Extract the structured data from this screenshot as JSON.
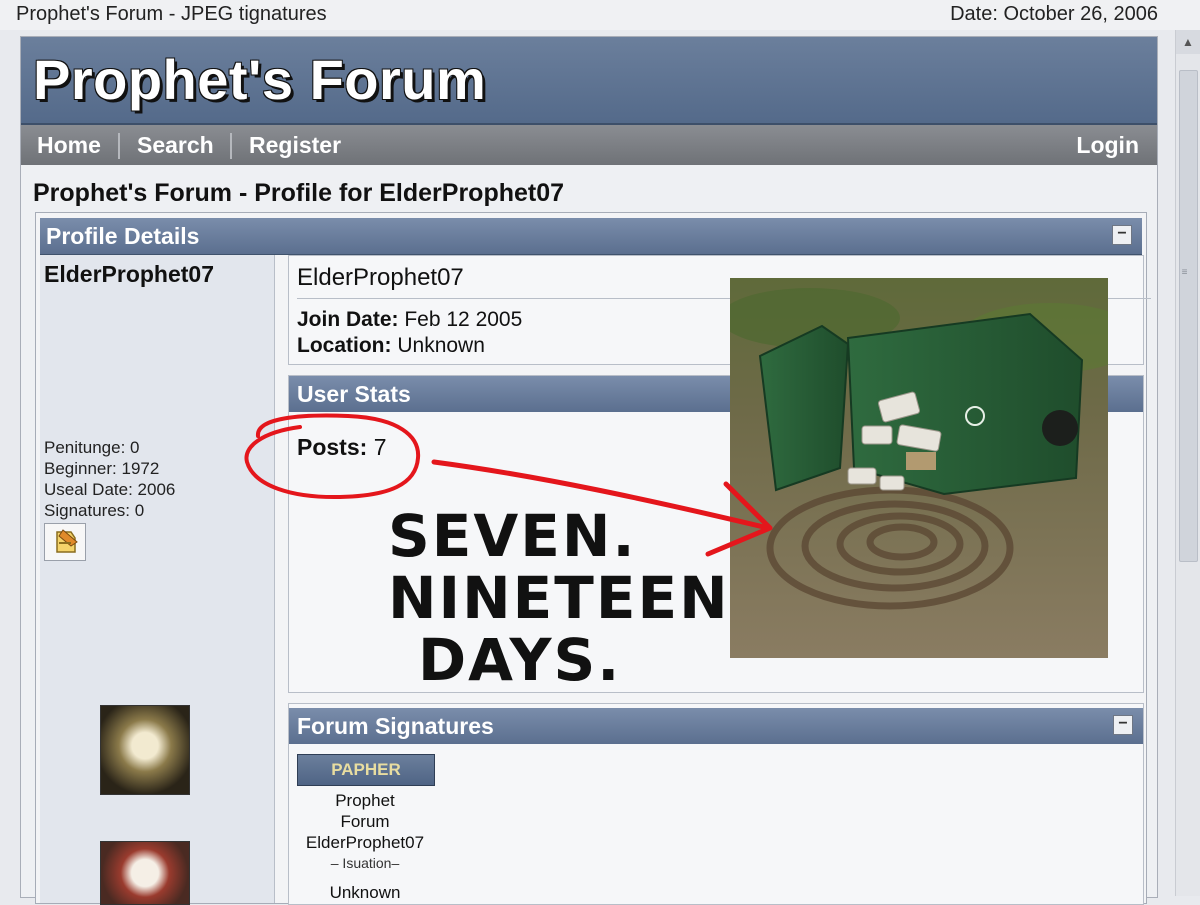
{
  "window": {
    "title": "Prophet's Forum - JPEG tignatures",
    "date": "Date: October 26, 2006"
  },
  "header": {
    "logo": "Prophet's Forum"
  },
  "nav": {
    "home": "Home",
    "search": "Search",
    "register": "Register",
    "login": "Login"
  },
  "page": {
    "title": "Prophet's Forum - Profile for ElderProphet07"
  },
  "profile_panel": {
    "title": "Profile Details",
    "collapse_symbol": "−",
    "sidebar": {
      "username": "ElderProphet07",
      "stats": [
        "Penitunge: 0",
        "Beginner: 1972",
        "Useal Date: 2006",
        "Signatures: 0"
      ]
    },
    "info": {
      "username": "ElderProphet07",
      "join_label": "Join Date:",
      "join_value": "Feb 12 2005",
      "location_label": "Location:",
      "location_value": "Unknown"
    },
    "user_stats": {
      "title": "User Stats",
      "posts_label": "Posts:",
      "posts_value": "7"
    },
    "signatures": {
      "title": "Forum Signatures",
      "badge": "PAPHER",
      "lines": [
        "Prophet",
        "Forum",
        "ElderProphet07"
      ],
      "sub": "– Isuation–",
      "tail": "Unknown"
    }
  },
  "annotation": {
    "lines": [
      "SEVEN.",
      "NINETEEN",
      "DAYS."
    ],
    "ink_color": "#e4161c"
  },
  "icons": {
    "edit": "edit-icon",
    "scroll_up": "▲"
  }
}
